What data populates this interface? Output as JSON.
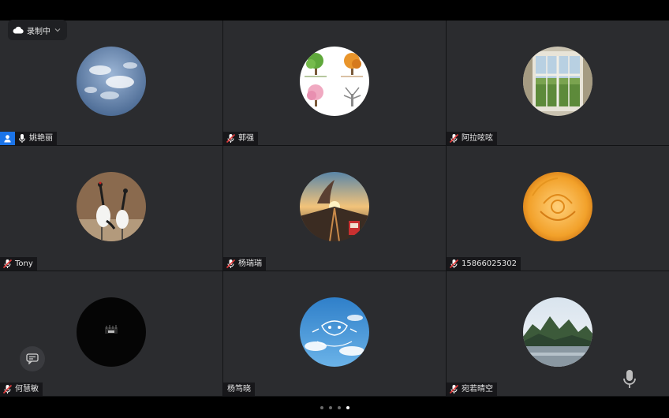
{
  "recording": {
    "label": "录制中"
  },
  "participants": [
    {
      "name": "姚艳丽",
      "host": true,
      "mic": "on",
      "avatar": "sky-clouds"
    },
    {
      "name": "郭强",
      "mic": "muted",
      "avatar": "four-seasons-trees"
    },
    {
      "name": "阿拉呟呟",
      "mic": "muted",
      "avatar": "window-landscape"
    },
    {
      "name": "Tony",
      "mic": "muted",
      "avatar": "red-crowned-cranes"
    },
    {
      "name": "杨瑞瑞",
      "mic": "muted",
      "avatar": "sunset-railway"
    },
    {
      "name": "15866025302",
      "mic": "muted",
      "avatar": "orange-rose"
    },
    {
      "name": "何慧敏",
      "mic": "muted",
      "avatar": "dark-scene"
    },
    {
      "name": "杨笃晓",
      "mic": "muted",
      "avatar": "cartoon-plane-sky"
    },
    {
      "name": "宛若晴空",
      "mic": "muted",
      "avatar": "karst-mountains"
    }
  ],
  "pagination": {
    "pages": 4,
    "current": 4
  },
  "icons": {
    "recording": "cloud-icon",
    "muted": "mic-muted-icon",
    "mic": "mic-icon",
    "host": "host-user-icon",
    "chat": "chat-icon"
  },
  "colors": {
    "host_badge": "#1b74e8",
    "tile_bg": "#2b2c2f",
    "muted_slash": "#e23b3b"
  }
}
